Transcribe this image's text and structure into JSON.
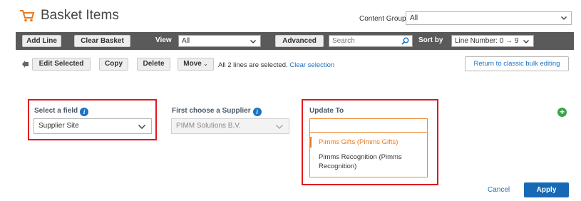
{
  "header": {
    "title": "Basket Items",
    "content_group_label": "Content Group",
    "content_group_value": "All"
  },
  "toolbar": {
    "add_line": "Add Line",
    "clear_basket": "Clear Basket",
    "view_label": "View",
    "view_value": "All",
    "advanced": "Advanced",
    "search_placeholder": "Search",
    "sort_label": "Sort by",
    "sort_value": "Line Number: 0 → 9"
  },
  "actions": {
    "edit_selected": "Edit Selected",
    "copy": "Copy",
    "delete": "Delete",
    "move": "Move",
    "selection_text": "All 2 lines are selected.",
    "clear_selection": "Clear selection",
    "classic_bulk": "Return to classic bulk editing"
  },
  "form": {
    "select_field_label": "Select a field",
    "select_field_value": "Supplier Site",
    "supplier_label": "First choose a Supplier",
    "supplier_value": "PIMM Solutions B.V.",
    "update_to_label": "Update To",
    "update_input_value": "",
    "options": [
      "Pimms Gifts (Pimms Gifts)",
      "Pimms Recognition (Pimms Recognition)"
    ]
  },
  "footer": {
    "cancel": "Cancel",
    "apply": "Apply"
  },
  "colors": {
    "highlight_box": "#e0181f",
    "accent_orange": "#e8781e",
    "link_blue": "#1a72c4",
    "apply_blue": "#1769b6",
    "toolbar_gray": "#5a5a5a"
  }
}
